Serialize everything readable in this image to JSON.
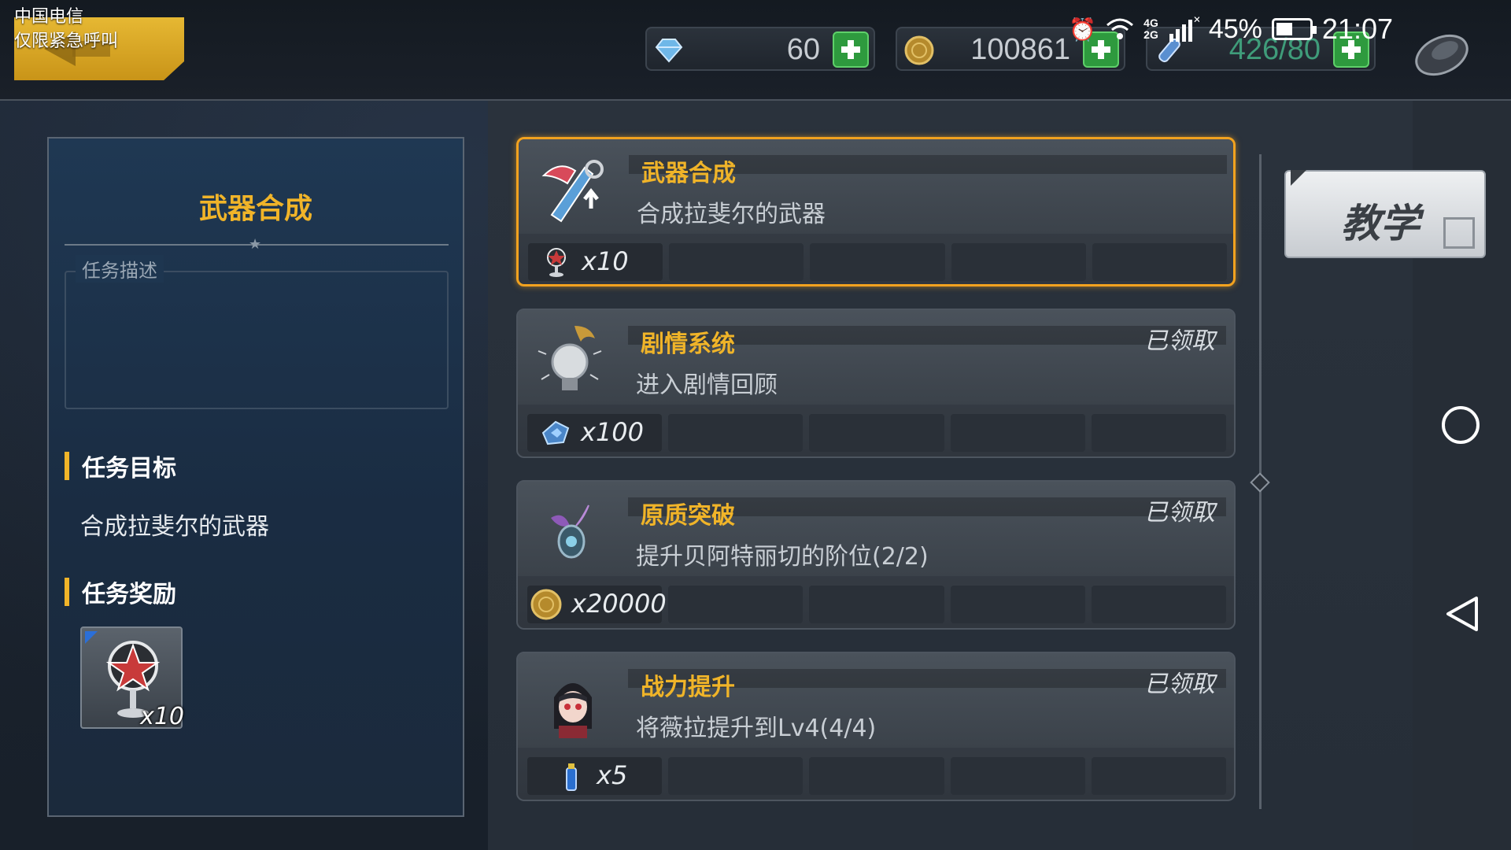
{
  "status_bar": {
    "carrier": "中国电信",
    "carrier_note": "仅限紧急呼叫",
    "network_top": "4G",
    "network_bottom": "2G",
    "battery": "45%",
    "time": "21:07"
  },
  "resources": {
    "diamonds": "60",
    "coins": "100861",
    "stamina": "426/80"
  },
  "left_panel": {
    "title": "武器合成",
    "desc_label": "任务描述",
    "description": "",
    "target_heading": "任务目标",
    "target_text": "合成拉斐尔的武器",
    "reward_heading": "任务奖励",
    "reward_qty": "x10"
  },
  "tasks": [
    {
      "name": "武器合成",
      "desc": "合成拉斐尔的武器",
      "status": "",
      "reward_icon": "pentagram-stand-icon",
      "reward_qty": "x10"
    },
    {
      "name": "剧情系统",
      "desc": "进入剧情回顾",
      "status": "已领取",
      "reward_icon": "crystal-icon",
      "reward_qty": "x100"
    },
    {
      "name": "原质突破",
      "desc": "提升贝阿特丽切的阶位(2/2)",
      "status": "已领取",
      "reward_icon": "coin-icon",
      "reward_qty": "x20000"
    },
    {
      "name": "战力提升",
      "desc": "将薇拉提升到Lv4(4/4)",
      "status": "已领取",
      "reward_icon": "exp-potion-icon",
      "reward_qty": "x5"
    }
  ],
  "teach_button": "教学",
  "colors": {
    "accent": "#f0b429",
    "active_border": "#f2a21f",
    "plus_green": "#2e9a3e"
  }
}
